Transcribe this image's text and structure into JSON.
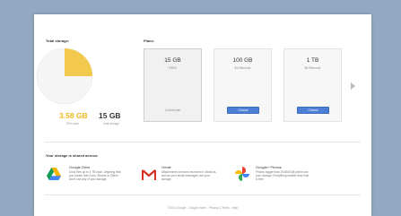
{
  "storage": {
    "title": "Total storage:",
    "used_value": "3.58 GB",
    "used_caption": "25% used",
    "total_value": "15 GB",
    "total_caption": "total storage",
    "used_fraction": 0.25,
    "used_color": "#f2c94c",
    "free_color": "#f5f5f5"
  },
  "plans": {
    "title": "Plans:",
    "items": [
      {
        "size": "15 GB",
        "price": "FREE!",
        "status": "Current plan"
      },
      {
        "size": "100 GB",
        "price": "$1.99/month",
        "button": "Choose"
      },
      {
        "size": "1 TB",
        "price": "$9.99/month",
        "button": "Choose"
      }
    ]
  },
  "shared": {
    "title": "Your storage is shared across:",
    "services": [
      {
        "name": "Google Drive",
        "desc": "Docs files up to 1 TB each. Anything that you create with Docs, Sheets or Slides won't use any of your storage.",
        "icon": "google-drive-icon"
      },
      {
        "name": "Gmail",
        "desc": "Attachments sent and received in Gmail as well as your email messages use your storage.",
        "icon": "gmail-icon"
      },
      {
        "name": "Google+ Photos",
        "desc": "Photos bigger than 2048x2048 pixels use your storage. Everything smaller than that is free.",
        "icon": "google-photos-icon"
      }
    ]
  },
  "footer": {
    "text": "©2014 Google - Google Home - Privacy & Terms - Help"
  },
  "colors": {
    "background": "#93a9c2",
    "accent": "#4d7fd4",
    "used": "#f2b820"
  }
}
